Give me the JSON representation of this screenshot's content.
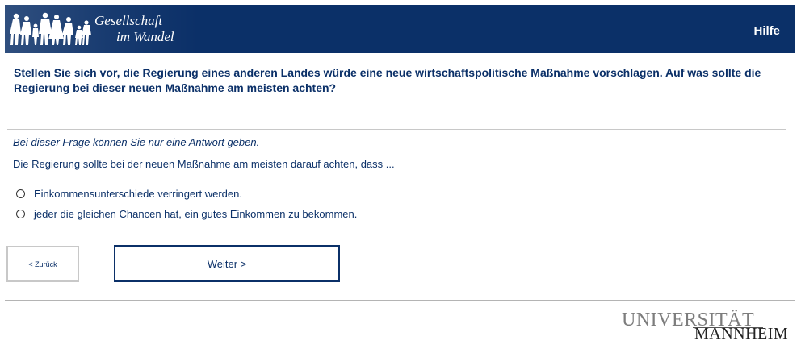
{
  "header": {
    "logo_line1": "Gesellschaft",
    "logo_line2": "im Wandel",
    "help_label": "Hilfe"
  },
  "question": {
    "text": "Stellen Sie sich vor, die Regierung eines anderen Landes würde eine neue wirtschaftspolitische Maßnahme vorschlagen. Auf was sollte die Regierung bei dieser neuen Maßnahme am meisten achten?",
    "hint": "Bei dieser Frage können Sie nur eine Antwort geben.",
    "stem": "Die Regierung sollte bei der neuen Maßnahme am meisten darauf achten, dass ..."
  },
  "options": [
    {
      "label": "Einkommensunterschiede verringert werden."
    },
    {
      "label": "jeder die gleichen Chancen hat, ein gutes Einkommen zu bekommen."
    }
  ],
  "nav": {
    "back_label": "< Zurück",
    "next_label": "Weiter >"
  },
  "footer": {
    "uni_line1": "UNIVERSITÄT",
    "uni_line2": "MANNHEIM"
  },
  "colors": {
    "brand_navy": "#0b3068",
    "text_navy": "#0b3068",
    "divider": "#c8c8c8"
  }
}
